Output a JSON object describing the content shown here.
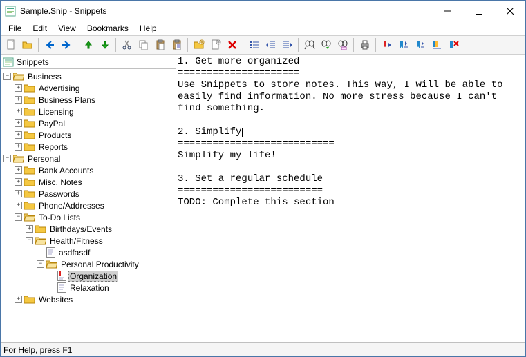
{
  "window": {
    "title": "Sample.Snip - Snippets"
  },
  "menus": {
    "file": "File",
    "edit": "Edit",
    "view": "View",
    "bookmarks": "Bookmarks",
    "help": "Help"
  },
  "tree": {
    "header": "Snippets",
    "business": "Business",
    "advertising": "Advertising",
    "business_plans": "Business Plans",
    "licensing": "Licensing",
    "paypal": "PayPal",
    "products": "Products",
    "reports": "Reports",
    "personal": "Personal",
    "bank_accounts": "Bank Accounts",
    "misc_notes": "Misc. Notes",
    "passwords": "Passwords",
    "phone_addresses": "Phone/Addresses",
    "todo_lists": "To-Do Lists",
    "birthdays_events": "Birthdays/Events",
    "health_fitness": "Health/Fitness",
    "asdfasdf": "asdfasdf",
    "personal_productivity": "Personal Productivity",
    "organization": "Organization",
    "relaxation": "Relaxation",
    "websites": "Websites"
  },
  "editor": {
    "line1": "1. Get more organized",
    "line2": "=====================",
    "line3": "Use Snippets to store notes. This way, I will be able to easily find information. No more stress because I can't find something.",
    "line4": "",
    "line5": "2. Simplify",
    "line6": "===========================",
    "line7": "Simplify my life!",
    "line8": "",
    "line9": "3. Set a regular schedule",
    "line10": "=========================",
    "line11": "TODO: Complete this section"
  },
  "status": {
    "text": "For Help, press F1"
  }
}
